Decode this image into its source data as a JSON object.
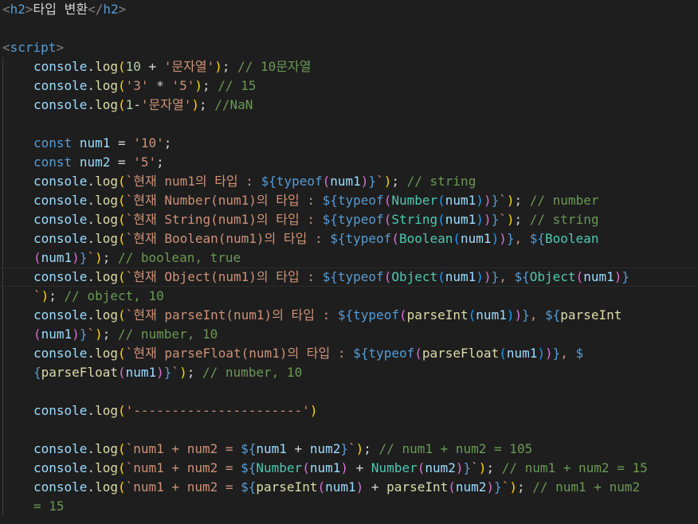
{
  "editor": {
    "colors": {
      "background": "#1e1e1e",
      "tag_bracket": "#808080",
      "tag_name": "#569cd6",
      "text": "#d4d4d4",
      "variable": "#9cdcfe",
      "function": "#dcdcaa",
      "string": "#ce9178",
      "number": "#b5cea8",
      "comment": "#6a9955",
      "keyword": "#569cd6",
      "class": "#4ec9b0",
      "brace_gold": "#ffd700",
      "brace_pink": "#da70d6",
      "brace_blue": "#179fff"
    },
    "lines": [
      {
        "indent": 0,
        "tokens": [
          [
            "<",
            "tb"
          ],
          [
            "h2",
            "tn"
          ],
          [
            ">",
            "tb"
          ],
          [
            "타입 변환",
            "tx"
          ],
          [
            "</",
            "tb"
          ],
          [
            "h2",
            "tn"
          ],
          [
            ">",
            "tb"
          ]
        ]
      },
      {
        "indent": 0,
        "tokens": []
      },
      {
        "indent": 0,
        "tokens": [
          [
            "<",
            "tb"
          ],
          [
            "script",
            "tn"
          ],
          [
            ">",
            "tb"
          ]
        ]
      },
      {
        "indent": 1,
        "tokens": [
          [
            "console",
            "v"
          ],
          [
            ".",
            "tx"
          ],
          [
            "log",
            "f"
          ],
          [
            "(",
            "y"
          ],
          [
            "10",
            "n"
          ],
          [
            " + ",
            "tx"
          ],
          [
            "'문자열'",
            "s"
          ],
          [
            ")",
            "y"
          ],
          [
            "; ",
            "tx"
          ],
          [
            "// 10문자열",
            "c"
          ]
        ]
      },
      {
        "indent": 1,
        "tokens": [
          [
            "console",
            "v"
          ],
          [
            ".",
            "tx"
          ],
          [
            "log",
            "f"
          ],
          [
            "(",
            "y"
          ],
          [
            "'3'",
            "s"
          ],
          [
            " * ",
            "tx"
          ],
          [
            "'5'",
            "s"
          ],
          [
            ")",
            "y"
          ],
          [
            "; ",
            "tx"
          ],
          [
            "// 15",
            "c"
          ]
        ]
      },
      {
        "indent": 1,
        "tokens": [
          [
            "console",
            "v"
          ],
          [
            ".",
            "tx"
          ],
          [
            "log",
            "f"
          ],
          [
            "(",
            "y"
          ],
          [
            "1",
            "n"
          ],
          [
            "-",
            "tx"
          ],
          [
            "'문자열'",
            "s"
          ],
          [
            ")",
            "y"
          ],
          [
            "; ",
            "tx"
          ],
          [
            "//NaN",
            "c"
          ]
        ]
      },
      {
        "indent": 1,
        "tokens": []
      },
      {
        "indent": 1,
        "tokens": [
          [
            "const",
            "k"
          ],
          [
            " ",
            "tx"
          ],
          [
            "num1",
            "v"
          ],
          [
            " = ",
            "tx"
          ],
          [
            "'10'",
            "s"
          ],
          [
            ";",
            "tx"
          ]
        ]
      },
      {
        "indent": 1,
        "tokens": [
          [
            "const",
            "k"
          ],
          [
            " ",
            "tx"
          ],
          [
            "num2",
            "v"
          ],
          [
            " = ",
            "tx"
          ],
          [
            "'5'",
            "s"
          ],
          [
            ";",
            "tx"
          ]
        ]
      },
      {
        "indent": 1,
        "tokens": [
          [
            "console",
            "v"
          ],
          [
            ".",
            "tx"
          ],
          [
            "log",
            "f"
          ],
          [
            "(",
            "y"
          ],
          [
            "`현재 num1의 타입 : ",
            "s"
          ],
          [
            "${",
            "k"
          ],
          [
            "typeof",
            "k"
          ],
          [
            "(",
            "p"
          ],
          [
            "num1",
            "v"
          ],
          [
            ")",
            "p"
          ],
          [
            "}",
            "k"
          ],
          [
            "`",
            "s"
          ],
          [
            ")",
            "y"
          ],
          [
            "; ",
            "tx"
          ],
          [
            "// string",
            "c"
          ]
        ]
      },
      {
        "indent": 1,
        "tokens": [
          [
            "console",
            "v"
          ],
          [
            ".",
            "tx"
          ],
          [
            "log",
            "f"
          ],
          [
            "(",
            "y"
          ],
          [
            "`현재 Number(num1)의 타입 : ",
            "s"
          ],
          [
            "${",
            "k"
          ],
          [
            "typeof",
            "k"
          ],
          [
            "(",
            "p"
          ],
          [
            "Number",
            "cl"
          ],
          [
            "(",
            "b"
          ],
          [
            "num1",
            "v"
          ],
          [
            ")",
            "b"
          ],
          [
            ")",
            "p"
          ],
          [
            "}",
            "k"
          ],
          [
            "`",
            "s"
          ],
          [
            ")",
            "y"
          ],
          [
            "; ",
            "tx"
          ],
          [
            "// number",
            "c"
          ]
        ]
      },
      {
        "indent": 1,
        "tokens": [
          [
            "console",
            "v"
          ],
          [
            ".",
            "tx"
          ],
          [
            "log",
            "f"
          ],
          [
            "(",
            "y"
          ],
          [
            "`현재 String(num1)의 타입 : ",
            "s"
          ],
          [
            "${",
            "k"
          ],
          [
            "typeof",
            "k"
          ],
          [
            "(",
            "p"
          ],
          [
            "String",
            "cl"
          ],
          [
            "(",
            "b"
          ],
          [
            "num1",
            "v"
          ],
          [
            ")",
            "b"
          ],
          [
            ")",
            "p"
          ],
          [
            "}",
            "k"
          ],
          [
            "`",
            "s"
          ],
          [
            ")",
            "y"
          ],
          [
            "; ",
            "tx"
          ],
          [
            "// string",
            "c"
          ]
        ]
      },
      {
        "indent": 1,
        "tokens": [
          [
            "console",
            "v"
          ],
          [
            ".",
            "tx"
          ],
          [
            "log",
            "f"
          ],
          [
            "(",
            "y"
          ],
          [
            "`현재 Boolean(num1)의 타입 : ",
            "s"
          ],
          [
            "${",
            "k"
          ],
          [
            "typeof",
            "k"
          ],
          [
            "(",
            "p"
          ],
          [
            "Boolean",
            "cl"
          ],
          [
            "(",
            "b"
          ],
          [
            "num1",
            "v"
          ],
          [
            ")",
            "b"
          ],
          [
            ")",
            "p"
          ],
          [
            "}",
            "k"
          ],
          [
            ", ",
            "s"
          ],
          [
            "${",
            "k"
          ],
          [
            "Boolean",
            "cl"
          ]
        ]
      },
      {
        "indent": 1,
        "tokens": [
          [
            "(",
            "p"
          ],
          [
            "num1",
            "v"
          ],
          [
            ")",
            "p"
          ],
          [
            "}",
            "k"
          ],
          [
            "`",
            "s"
          ],
          [
            ")",
            "y"
          ],
          [
            "; ",
            "tx"
          ],
          [
            "// boolean, true",
            "c"
          ]
        ]
      },
      {
        "indent": 1,
        "tokens": [
          [
            "console",
            "v"
          ],
          [
            ".",
            "tx"
          ],
          [
            "log",
            "f"
          ],
          [
            "(",
            "y"
          ],
          [
            "`현재 Object(num1)의 타입 : ",
            "s"
          ],
          [
            "${",
            "k"
          ],
          [
            "typeof",
            "k"
          ],
          [
            "(",
            "p"
          ],
          [
            "Object",
            "cl"
          ],
          [
            "(",
            "b"
          ],
          [
            "num1",
            "v"
          ],
          [
            ")",
            "b"
          ],
          [
            ")",
            "p"
          ],
          [
            "}",
            "k"
          ],
          [
            ", ",
            "s"
          ],
          [
            "${",
            "k"
          ],
          [
            "Object",
            "cl"
          ],
          [
            "(",
            "p"
          ],
          [
            "num1",
            "v"
          ],
          [
            ")",
            "p"
          ],
          [
            "}",
            "k"
          ]
        ],
        "current": true
      },
      {
        "indent": 1,
        "tokens": [
          [
            "`",
            "s"
          ],
          [
            ")",
            "y"
          ],
          [
            "; ",
            "tx"
          ],
          [
            "// object, 10",
            "c"
          ]
        ]
      },
      {
        "indent": 1,
        "tokens": [
          [
            "console",
            "v"
          ],
          [
            ".",
            "tx"
          ],
          [
            "log",
            "f"
          ],
          [
            "(",
            "y"
          ],
          [
            "`현재 parseInt(num1)의 타입 : ",
            "s"
          ],
          [
            "${",
            "k"
          ],
          [
            "typeof",
            "k"
          ],
          [
            "(",
            "p"
          ],
          [
            "parseInt",
            "f"
          ],
          [
            "(",
            "b"
          ],
          [
            "num1",
            "v"
          ],
          [
            ")",
            "b"
          ],
          [
            ")",
            "p"
          ],
          [
            "}",
            "k"
          ],
          [
            ", ",
            "s"
          ],
          [
            "${",
            "k"
          ],
          [
            "parseInt",
            "f"
          ]
        ]
      },
      {
        "indent": 1,
        "tokens": [
          [
            "(",
            "p"
          ],
          [
            "num1",
            "v"
          ],
          [
            ")",
            "p"
          ],
          [
            "}",
            "k"
          ],
          [
            "`",
            "s"
          ],
          [
            ")",
            "y"
          ],
          [
            "; ",
            "tx"
          ],
          [
            "// number, 10",
            "c"
          ]
        ]
      },
      {
        "indent": 1,
        "tokens": [
          [
            "console",
            "v"
          ],
          [
            ".",
            "tx"
          ],
          [
            "log",
            "f"
          ],
          [
            "(",
            "y"
          ],
          [
            "`현재 parseFloat(num1)의 타입 : ",
            "s"
          ],
          [
            "${",
            "k"
          ],
          [
            "typeof",
            "k"
          ],
          [
            "(",
            "p"
          ],
          [
            "parseFloat",
            "f"
          ],
          [
            "(",
            "b"
          ],
          [
            "num1",
            "v"
          ],
          [
            ")",
            "b"
          ],
          [
            ")",
            "p"
          ],
          [
            "}",
            "k"
          ],
          [
            ", ",
            "s"
          ],
          [
            "$",
            "k"
          ]
        ]
      },
      {
        "indent": 1,
        "tokens": [
          [
            "{",
            "k"
          ],
          [
            "parseFloat",
            "f"
          ],
          [
            "(",
            "p"
          ],
          [
            "num1",
            "v"
          ],
          [
            ")",
            "p"
          ],
          [
            "}",
            "k"
          ],
          [
            "`",
            "s"
          ],
          [
            ")",
            "y"
          ],
          [
            "; ",
            "tx"
          ],
          [
            "// number, 10",
            "c"
          ]
        ]
      },
      {
        "indent": 1,
        "tokens": []
      },
      {
        "indent": 1,
        "tokens": [
          [
            "console",
            "v"
          ],
          [
            ".",
            "tx"
          ],
          [
            "log",
            "f"
          ],
          [
            "(",
            "y"
          ],
          [
            "'----------------------'",
            "s"
          ],
          [
            ")",
            "y"
          ]
        ]
      },
      {
        "indent": 1,
        "tokens": []
      },
      {
        "indent": 1,
        "tokens": [
          [
            "console",
            "v"
          ],
          [
            ".",
            "tx"
          ],
          [
            "log",
            "f"
          ],
          [
            "(",
            "y"
          ],
          [
            "`num1 + num2 = ",
            "s"
          ],
          [
            "${",
            "k"
          ],
          [
            "num1",
            "v"
          ],
          [
            " + ",
            "tx"
          ],
          [
            "num2",
            "v"
          ],
          [
            "}",
            "k"
          ],
          [
            "`",
            "s"
          ],
          [
            ")",
            "y"
          ],
          [
            "; ",
            "tx"
          ],
          [
            "// num1 + num2 = 105",
            "c"
          ]
        ]
      },
      {
        "indent": 1,
        "tokens": [
          [
            "console",
            "v"
          ],
          [
            ".",
            "tx"
          ],
          [
            "log",
            "f"
          ],
          [
            "(",
            "y"
          ],
          [
            "`num1 + num2 = ",
            "s"
          ],
          [
            "${",
            "k"
          ],
          [
            "Number",
            "cl"
          ],
          [
            "(",
            "p"
          ],
          [
            "num1",
            "v"
          ],
          [
            ")",
            "p"
          ],
          [
            " + ",
            "tx"
          ],
          [
            "Number",
            "cl"
          ],
          [
            "(",
            "p"
          ],
          [
            "num2",
            "v"
          ],
          [
            ")",
            "p"
          ],
          [
            "}",
            "k"
          ],
          [
            "`",
            "s"
          ],
          [
            ")",
            "y"
          ],
          [
            "; ",
            "tx"
          ],
          [
            "// num1 + num2 = 15",
            "c"
          ]
        ]
      },
      {
        "indent": 1,
        "tokens": [
          [
            "console",
            "v"
          ],
          [
            ".",
            "tx"
          ],
          [
            "log",
            "f"
          ],
          [
            "(",
            "y"
          ],
          [
            "`num1 + num2 = ",
            "s"
          ],
          [
            "${",
            "k"
          ],
          [
            "parseInt",
            "f"
          ],
          [
            "(",
            "p"
          ],
          [
            "num1",
            "v"
          ],
          [
            ")",
            "p"
          ],
          [
            " + ",
            "tx"
          ],
          [
            "parseInt",
            "f"
          ],
          [
            "(",
            "p"
          ],
          [
            "num2",
            "v"
          ],
          [
            ")",
            "p"
          ],
          [
            "}",
            "k"
          ],
          [
            "`",
            "s"
          ],
          [
            ")",
            "y"
          ],
          [
            "; ",
            "tx"
          ],
          [
            "// num1 + num2",
            "c"
          ]
        ]
      },
      {
        "indent": 1,
        "tokens": [
          [
            "= 15",
            "c"
          ]
        ]
      }
    ]
  }
}
